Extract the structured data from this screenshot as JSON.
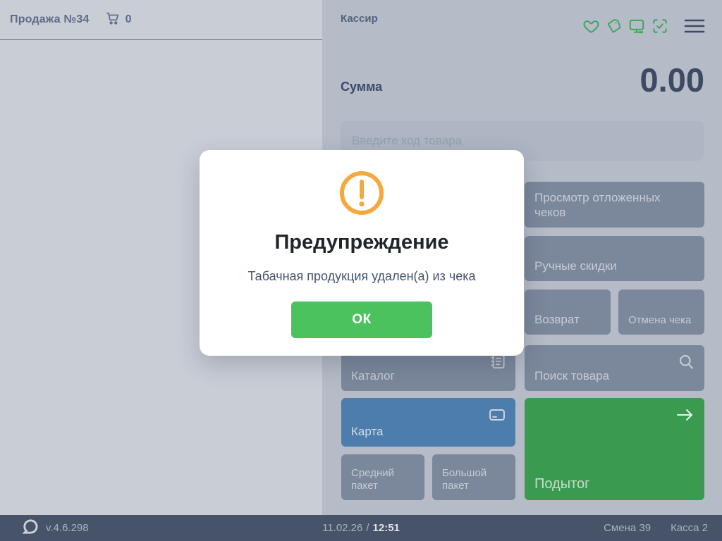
{
  "left_panel": {
    "title": "Продажа №34",
    "cart_count": "0"
  },
  "right_panel": {
    "cashier_label": "Кассир",
    "sum_label": "Сумма",
    "sum_value": "0.00",
    "input_placeholder": "Введите код товара",
    "buttons": {
      "deferred_checks": "Просмотр отложенных чеков",
      "manual_discounts": "Ручные скидки",
      "refund": "Возврат",
      "cancel_check": "Отмена чека",
      "catalog": "Каталог",
      "search_product": "Поиск товара",
      "card": "Карта",
      "medium_bag": "Средний пакет",
      "big_bag": "Большой пакет",
      "subtotal": "Подытог"
    },
    "header_icon_names": [
      "heart-icon",
      "tag-icon",
      "monitor-icon",
      "scan-check-icon",
      "menu-icon"
    ]
  },
  "modal": {
    "title": "Предупреждение",
    "message": "Табачная продукция удален(а) из чека",
    "ok_label": "ОК",
    "icon": "warning-icon"
  },
  "status_bar": {
    "version": "v.4.6.298",
    "date": "11.02.26",
    "separator": "/",
    "time": "12:51",
    "shift": "Смена 39",
    "register": "Касса 2"
  },
  "colors": {
    "left_panel_bg": "#c9cdd6",
    "right_panel_bg": "#b5bbc7",
    "gray_button": "#7b879b",
    "blue_card_button": "#4d7dac",
    "green_subtotal_button": "#3a9b50",
    "ok_button_green": "#4cc25e",
    "warning_orange": "#f7a83d",
    "green_icons": "#3ca65a",
    "status_bar_bg": "#475369",
    "dark_text": "#3d4a63"
  }
}
